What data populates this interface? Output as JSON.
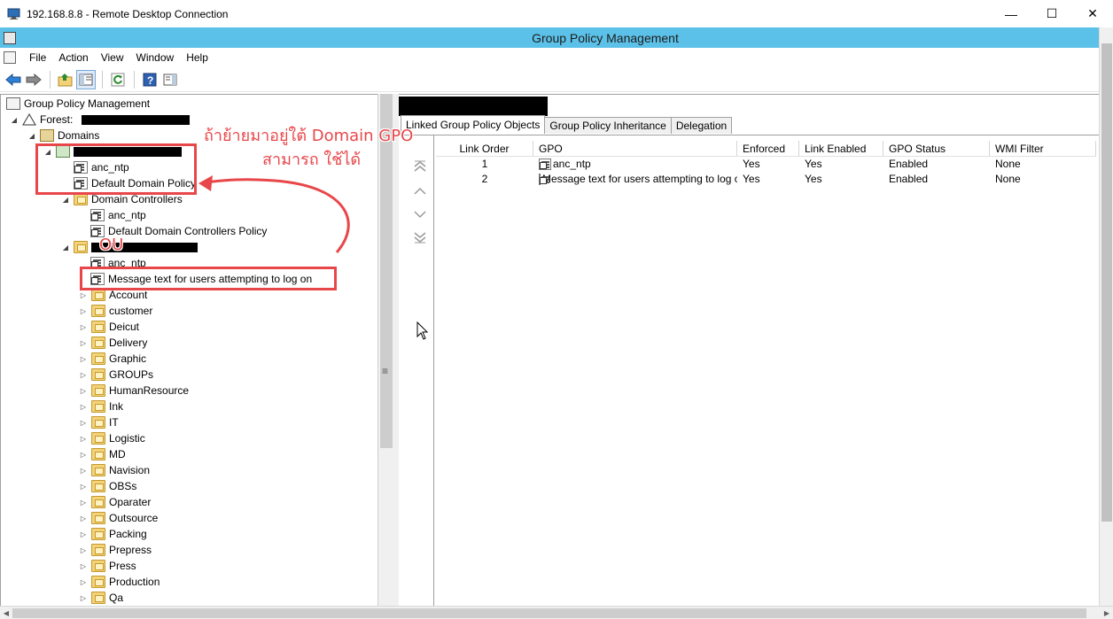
{
  "rdp": {
    "title": "192.168.8.8 - Remote Desktop Connection",
    "minimize": "—",
    "maximize": "☐",
    "close": "✕"
  },
  "app": {
    "title": "Group Policy Management"
  },
  "menu": [
    "File",
    "Action",
    "View",
    "Window",
    "Help"
  ],
  "tree": {
    "root": "Group Policy Management",
    "forest": "Forest:",
    "domains": "Domains",
    "domain_children": [
      "anc_ntp",
      "Default Domain Policy"
    ],
    "domain_controllers": "Domain Controllers",
    "dc_children": [
      "anc_ntp",
      "Default Domain Controllers Policy"
    ],
    "ou_children": [
      "anc_ntp",
      "Message text for users attempting to log on"
    ],
    "ous": [
      "Account",
      "customer",
      "Deicut",
      "Delivery",
      "Graphic",
      "GROUPs",
      "HumanResource",
      "Ink",
      "IT",
      "Logistic",
      "MD",
      "Navision",
      "OBSs",
      "Oparater",
      "Outsource",
      "Packing",
      "Prepress",
      "Press",
      "Production",
      "Qa"
    ]
  },
  "tabs": [
    "Linked Group Policy Objects",
    "Group Policy Inheritance",
    "Delegation"
  ],
  "grid": {
    "headers": [
      "Link Order",
      "GPO",
      "Enforced",
      "Link Enabled",
      "GPO Status",
      "WMI Filter"
    ],
    "rows": [
      {
        "order": "1",
        "gpo": "anc_ntp",
        "enforced": "Yes",
        "link_enabled": "Yes",
        "status": "Enabled",
        "wmi": "None"
      },
      {
        "order": "2",
        "gpo": "Message text for users attempting to log on",
        "enforced": "Yes",
        "link_enabled": "Yes",
        "status": "Enabled",
        "wmi": "None"
      }
    ]
  },
  "annotations": {
    "line1": "ถ้าย้ายมาอยู่ใต้ Domain GPO",
    "line2": "สามารถ ใช้ได้",
    "ou_label": "OU",
    "color": "#e8474a"
  }
}
